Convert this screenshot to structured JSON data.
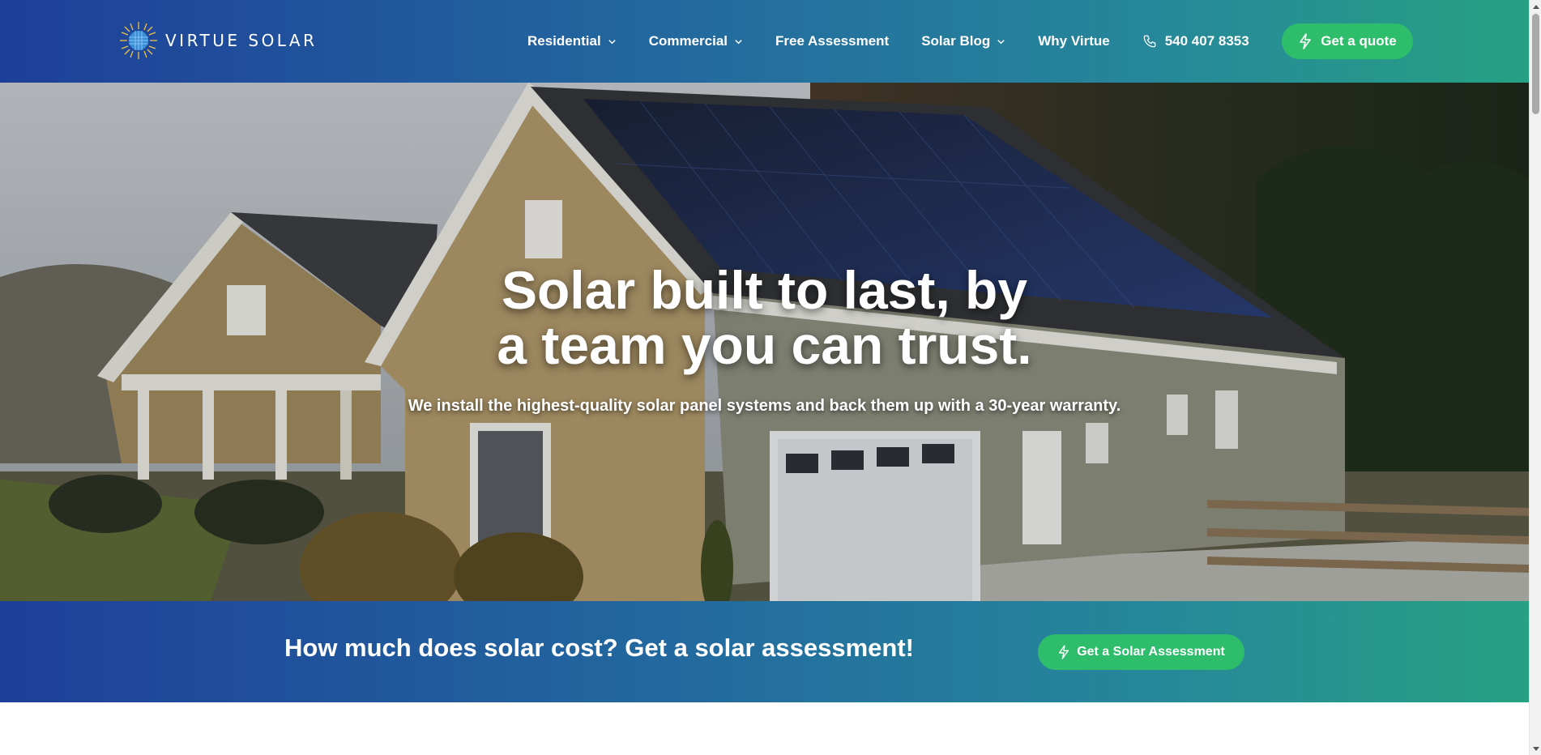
{
  "brand": {
    "name": "VIRTUE SOLAR",
    "logo_icon": "sunburst-logo-icon"
  },
  "nav": {
    "items": [
      {
        "label": "Residential",
        "dropdown": true
      },
      {
        "label": "Commercial",
        "dropdown": true
      },
      {
        "label": "Free Assessment",
        "dropdown": false
      },
      {
        "label": "Solar Blog",
        "dropdown": true
      },
      {
        "label": "Why Virtue",
        "dropdown": false
      }
    ],
    "phone": "540 407 8353",
    "quote_label": "Get a quote"
  },
  "hero": {
    "title_line1": "Solar built to last, by",
    "title_line2": "a team you can trust.",
    "subtitle": "We install the highest-quality solar panel systems and back them up with a 30-year warranty."
  },
  "cta": {
    "text": "How much does solar cost? Get a solar assessment!",
    "button_label": "Get a Solar Assessment"
  },
  "colors": {
    "gradient_start": "#1e3f99",
    "gradient_end": "#26a183",
    "button_green": "#2ebd6b"
  }
}
